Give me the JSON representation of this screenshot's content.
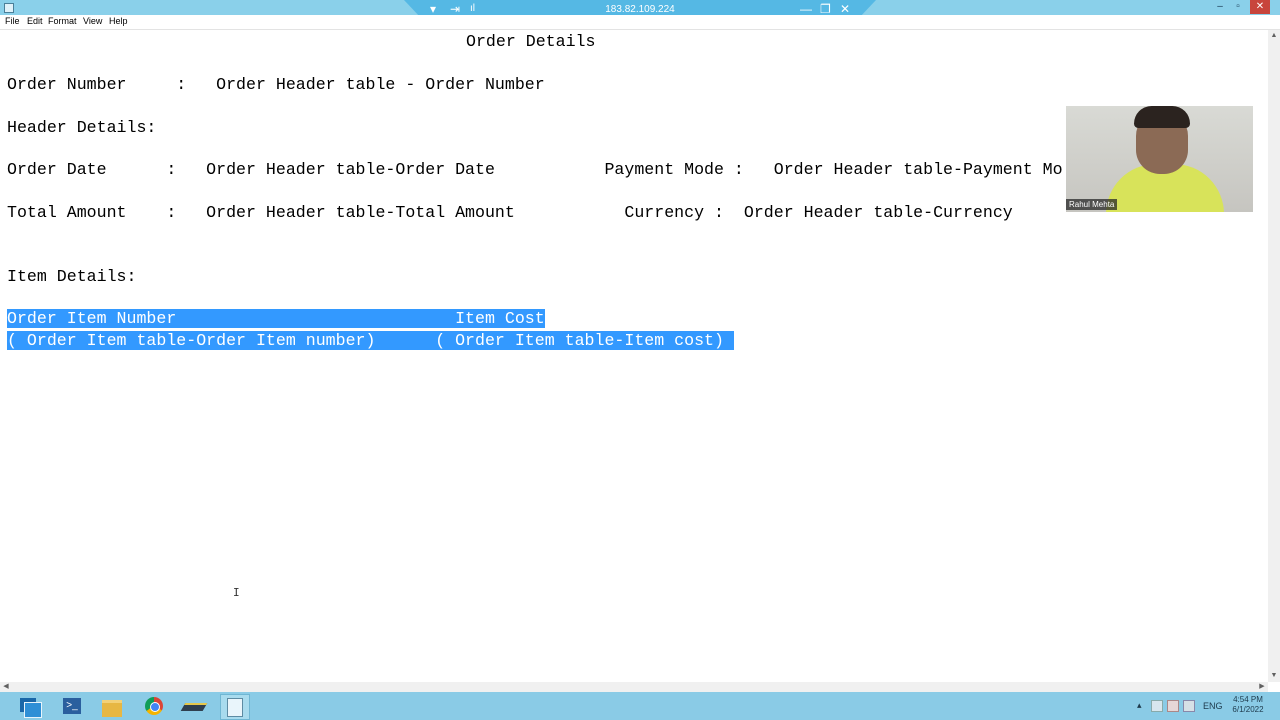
{
  "remote_bar": {
    "host": "183.82.109.224",
    "dropdown_glyph": "▾",
    "pin_glyph": "⇥",
    "signal_glyph": "ıl",
    "minimize_glyph": "—",
    "restore_glyph": "❐",
    "close_glyph": "✕"
  },
  "window_controls": {
    "minimize_glyph": "–",
    "restore_glyph": "▫",
    "close_glyph": "✕"
  },
  "menu": [
    "File",
    "Edit",
    "Format",
    "View",
    "Help"
  ],
  "document": {
    "title": "Order Details",
    "order_number_line": "Order Number     :   Order Header table - Order Number",
    "header_details_label": "Header Details:",
    "order_date_line": "Order Date      :   Order Header table-Order Date           Payment Mode :   Order Header table-Payment Mo",
    "total_amount_line": "Total Amount    :   Order Header table-Total Amount           Currency :  Order Header table-Currency",
    "item_details_label": "Item Details:",
    "selected_line_1": "Order Item Number                            Item Cost",
    "selected_line_2": "( Order Item table-Order Item number)      ( Order Item table-Item cost) "
  },
  "video": {
    "participant_name": "Rahul Mehta"
  },
  "cursor_glyph": "I",
  "taskbar": {
    "tray_up_glyph": "▴",
    "language": "ENG",
    "time": "4:54 PM",
    "date": "6/1/2022"
  },
  "scroll_glyphs": {
    "up": "▲",
    "down": "▼",
    "left": "◀",
    "right": "▶"
  },
  "colors": {
    "selection": "#3399ff",
    "taskbar": "#8acbe6",
    "remote_bar": "#55b8e4"
  }
}
